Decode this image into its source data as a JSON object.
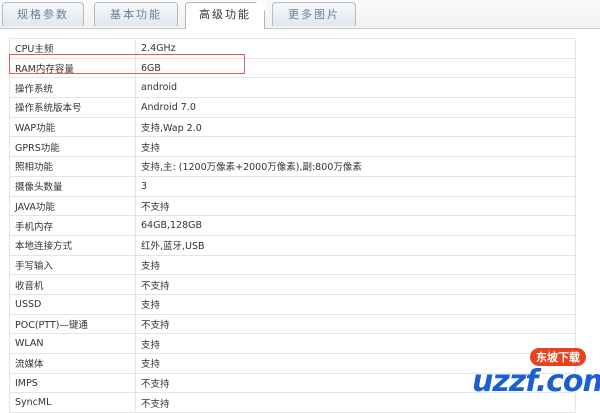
{
  "tabs": [
    {
      "label": "规格参数",
      "active": false
    },
    {
      "label": "基本功能",
      "active": false
    },
    {
      "label": "高级功能",
      "active": true
    },
    {
      "label": "更多图片",
      "active": false
    }
  ],
  "rows": [
    {
      "key": "CPU主频",
      "value": "2.4GHz"
    },
    {
      "key": "RAM内存容量",
      "value": "6GB",
      "highlighted": true
    },
    {
      "key": "操作系统",
      "value": "android"
    },
    {
      "key": "操作系统版本号",
      "value": "Android 7.0"
    },
    {
      "key": "WAP功能",
      "value": "支持,Wap 2.0"
    },
    {
      "key": "GPRS功能",
      "value": "支持"
    },
    {
      "key": "照相功能",
      "value": "支持,主: (1200万像素+2000万像素),副:800万像素"
    },
    {
      "key": "摄像头数量",
      "value": "3"
    },
    {
      "key": "JAVA功能",
      "value": "不支持"
    },
    {
      "key": "手机内存",
      "value": "64GB,128GB"
    },
    {
      "key": "本地连接方式",
      "value": "红外,蓝牙,USB"
    },
    {
      "key": "手写输入",
      "value": "支持"
    },
    {
      "key": "收音机",
      "value": "不支持"
    },
    {
      "key": "USSD",
      "value": "支持"
    },
    {
      "key": "POC(PTT)—键通",
      "value": "不支持"
    },
    {
      "key": "WLAN",
      "value": "支持"
    },
    {
      "key": "流媒体",
      "value": "支持"
    },
    {
      "key": "IMPS",
      "value": "不支持"
    },
    {
      "key": "SyncML",
      "value": "不支持"
    }
  ],
  "watermark": {
    "brand": "uzzf.com",
    "tagline": "东坡下载"
  },
  "colors": {
    "highlight": "#e25a5a",
    "tab_text": "#6a7f9a",
    "brand": "#1c5fd0"
  }
}
